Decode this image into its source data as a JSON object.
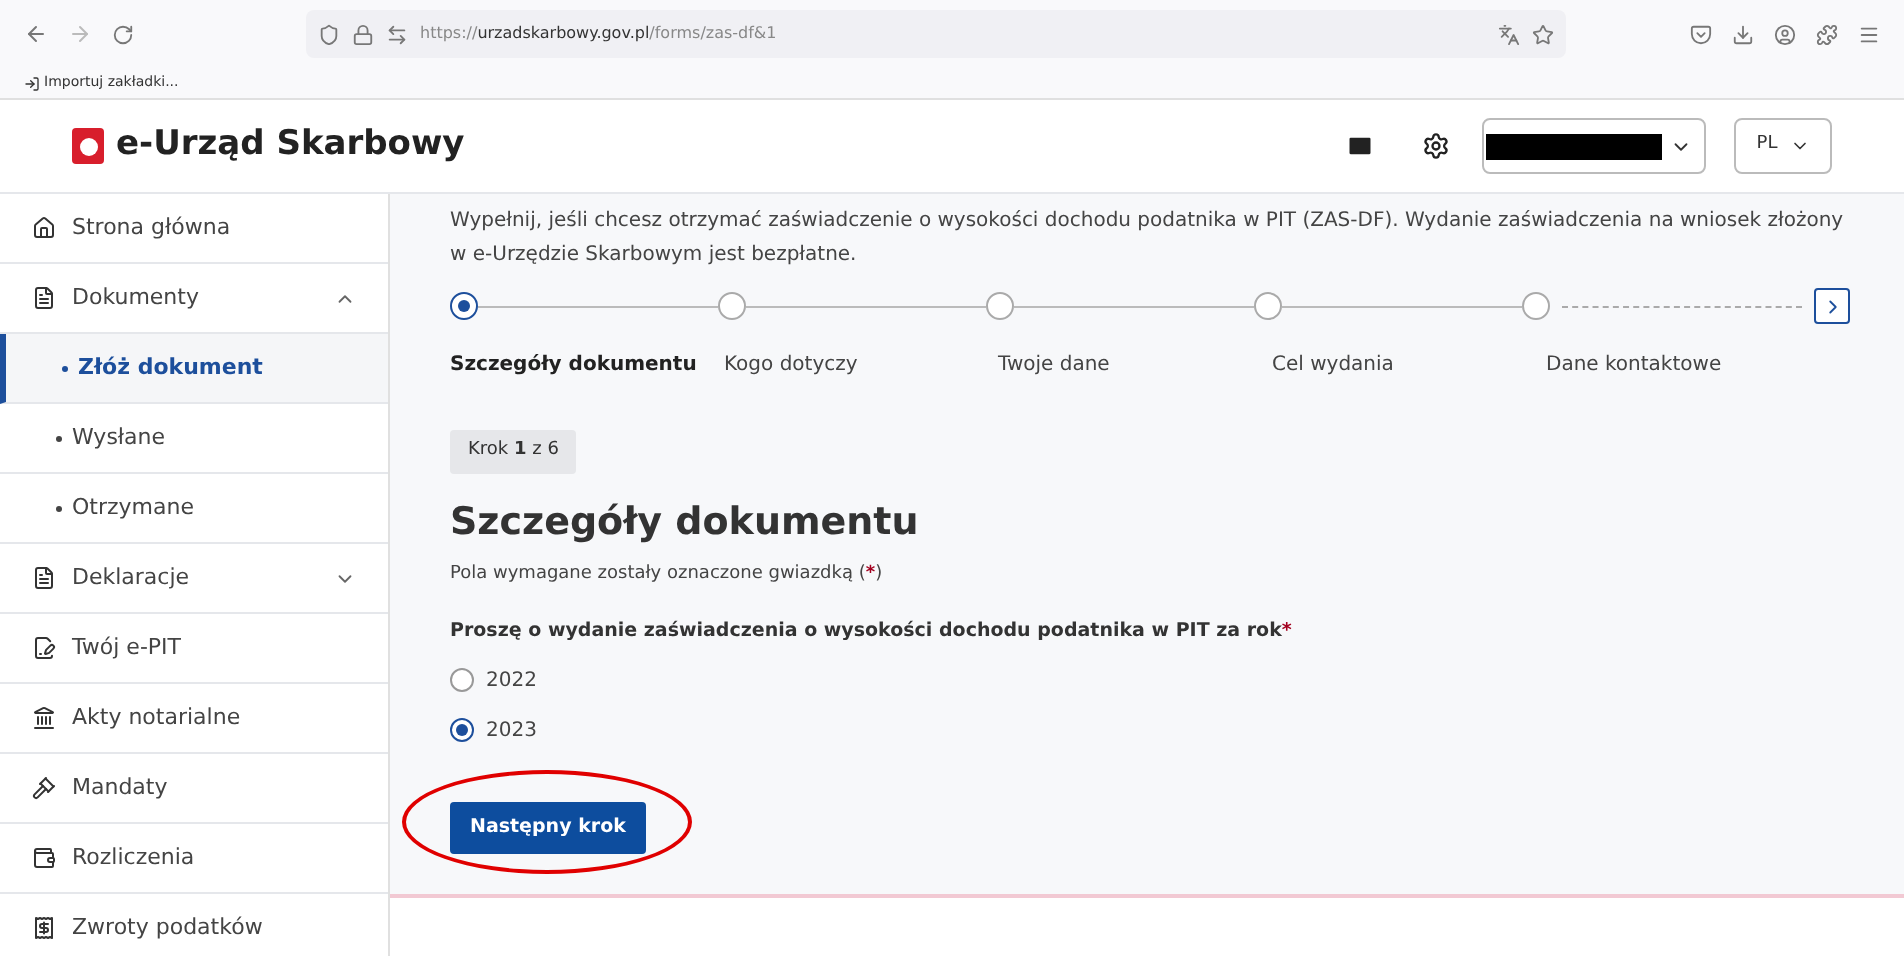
{
  "browser": {
    "url": {
      "scheme": "https://",
      "domain": "urzadskarbowy.gov.pl",
      "path": "/forms/zas-df&1"
    },
    "bookmarks": [
      "Importuj zakładki..."
    ]
  },
  "header": {
    "logo": "e-Urząd Skarbowy",
    "language": "PL"
  },
  "sidebar": {
    "items": [
      {
        "kind": "item",
        "label": "Strona główna"
      },
      {
        "kind": "group",
        "label": "Dokumenty",
        "expanded": true
      },
      {
        "kind": "subitem",
        "label": "Złóż dokument",
        "selected": true
      },
      {
        "kind": "subitem",
        "label": "Wysłane",
        "selected": false
      },
      {
        "kind": "subitem",
        "label": "Otrzymane",
        "selected": false
      },
      {
        "kind": "group",
        "label": "Deklaracje",
        "expanded": false
      },
      {
        "kind": "item",
        "label": "Twój e-PIT"
      },
      {
        "kind": "item",
        "label": "Akty notarialne"
      },
      {
        "kind": "item",
        "label": "Mandaty"
      },
      {
        "kind": "item",
        "label": "Rozliczenia"
      },
      {
        "kind": "item",
        "label": "Zwroty podatków"
      }
    ]
  },
  "intro": "Wypełnij, jeśli chcesz otrzymać zaświadczenie o wysokości dochodu podatnika w PIT (ZAS-DF). Wydanie zaświadczenia na wniosek złożony w e-Urzędzie Skarbowym jest bezpłatne.",
  "steps": [
    {
      "label": "Szczegóły dokumentu",
      "selected": true
    },
    {
      "label": "Kogo dotyczy",
      "selected": false
    },
    {
      "label": "Twoje dane",
      "selected": false
    },
    {
      "label": "Cel wydania",
      "selected": false
    },
    {
      "label": "Dane kontaktowe",
      "selected": false
    }
  ],
  "step_counter": "Krok **1** z 6",
  "title": "Szczegóły dokumentu",
  "required_note": {
    "text": "Pola wymagane zostały oznaczone gwiazdką (",
    "mark": "*",
    "close": ")"
  },
  "question": {
    "label": "Proszę o wydanie zaświadczenia o wysokości dochodu podatnika w PIT za rok",
    "mark": "*"
  },
  "options": [
    {
      "label": "2022",
      "selected": false
    },
    {
      "label": "2023",
      "selected": true
    }
  ],
  "next_button": "Następny krok",
  "annotation": {
    "circled": true
  }
}
